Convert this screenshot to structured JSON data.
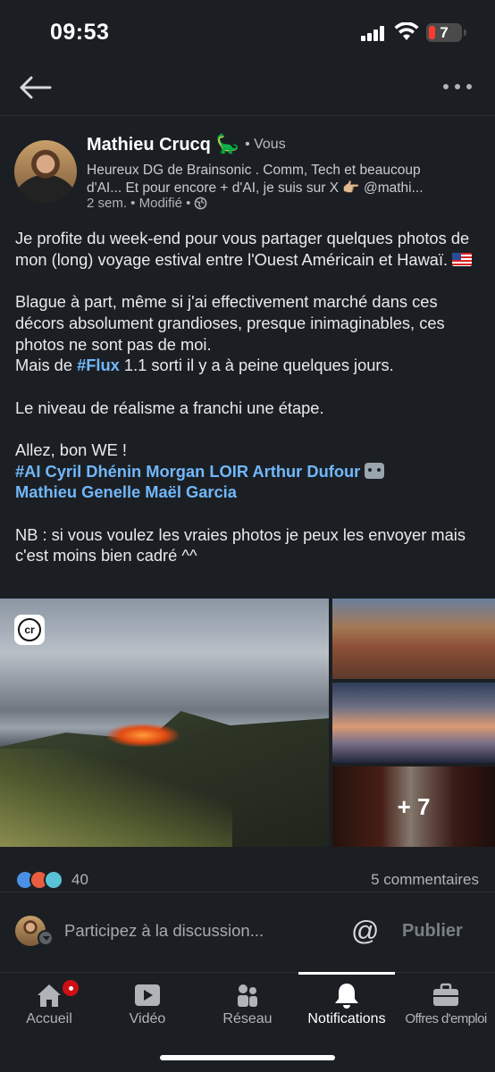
{
  "status_bar": {
    "time": "09:53",
    "battery": "7"
  },
  "author": {
    "name": "Mathieu Crucq",
    "emoji": "🦕",
    "relation": "• Vous",
    "headline_line1": "Heureux DG de Brainsonic . Comm, Tech et beaucoup",
    "headline_line2": "d'AI... Et pour encore + d'AI, je suis sur X 👉🏼 @mathi...",
    "meta": "2 sem. • Modifié •",
    "visibility_icon": "globe-icon"
  },
  "post": {
    "p1": "Je profite du week-end pour vous partager quelques photos de mon (long) voyage estival entre l'Ouest Américain et Hawaï.",
    "p2_line1": "Blague à part, même si j'ai effectivement marché dans ces décors absolument grandioses, presque inimaginables, ces photos ne sont pas de moi.",
    "p2_before_link": "Mais de ",
    "p2_link": "#Flux",
    "p2_after_link": " 1.1 sorti il y a à peine quelques jours.",
    "p3": "Le niveau de réalisme a franchi une étape.",
    "p4": "Allez, bon WE !",
    "tags_line1": "#AI Cyril Dhénin Morgan LOIR Arthur Dufour",
    "tags_line2": "Mathieu Genelle Maël Garcia",
    "p5": "NB : si vous voulez les vraies photos je peux les envoyer mais c'est moins bien cadré ^^"
  },
  "gallery": {
    "badge": "cr",
    "more": "+ 7"
  },
  "stats": {
    "reactions": "40",
    "comments": "5 commentaires"
  },
  "composer": {
    "placeholder": "Participez à la discussion...",
    "mention": "@",
    "publish": "Publier"
  },
  "tabs": [
    {
      "label": "Accueil",
      "icon": "home-icon"
    },
    {
      "label": "Vidéo",
      "icon": "video-icon"
    },
    {
      "label": "Réseau",
      "icon": "network-icon"
    },
    {
      "label": "Notifications",
      "icon": "bell-icon"
    },
    {
      "label": "Offres d'emploi",
      "icon": "briefcase-icon"
    }
  ]
}
